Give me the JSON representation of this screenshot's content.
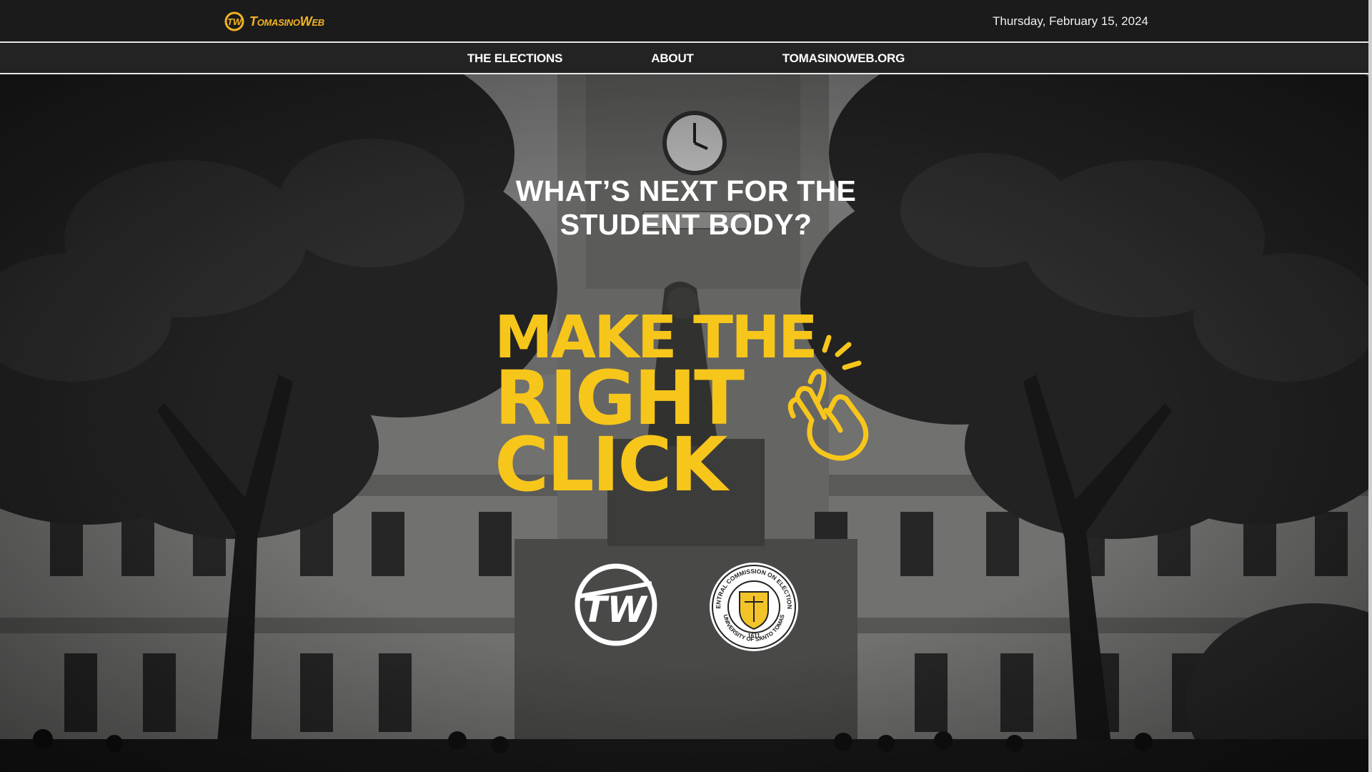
{
  "header": {
    "logo_text": "TomasinoWeb",
    "date": "Thursday, February 15, 2024"
  },
  "nav": {
    "items": [
      "THE ELECTIONS",
      "ABOUT",
      "TOMASINOWEB.ORG"
    ]
  },
  "hero": {
    "headline_line1": "WHAT’S NEXT FOR THE",
    "headline_line2": "STUDENT BODY?",
    "slogan_line1": "MAKE THE",
    "slogan_line2": "RIGHT",
    "slogan_line3": "CLICK",
    "emblem_text": "TW",
    "seal_text_top": "CENTRAL COMMISSION ON ELECTIONS",
    "seal_text_bottom": "UNIVERSITY OF SANTO TOMAS",
    "seal_year": "1611"
  },
  "colors": {
    "accent_yellow": "#f7c61b",
    "logo_orange": "#f2b323",
    "topbar": "#1b1b1b"
  }
}
